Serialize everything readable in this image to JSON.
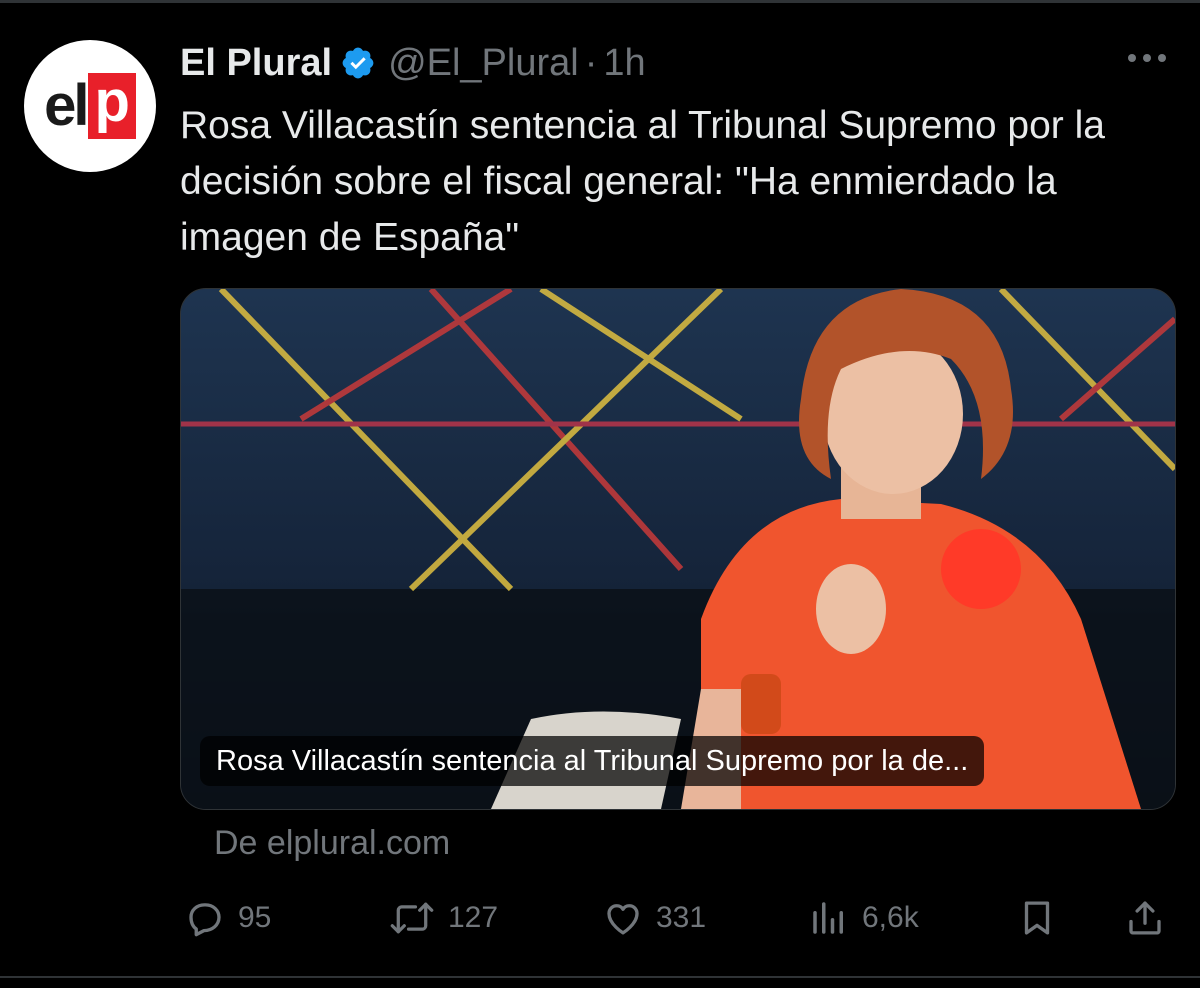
{
  "account": {
    "name": "El Plural",
    "handle": "@El_Plural",
    "separator": "·",
    "time": "1h",
    "logo_text_dark": "el",
    "logo_text_light": "p",
    "brand_red": "#e8202a",
    "verified_color": "#1d9bf0"
  },
  "tweet": {
    "text": "Rosa Villacastín sentencia al Tribunal Supremo por la decisión sobre el fiscal general: \"Ha enmierdado la imagen de España\""
  },
  "link_card": {
    "caption": "Rosa Villacastín sentencia al Tribunal Supremo por la de...",
    "source": "De elplural.com"
  },
  "actions": {
    "replies": "95",
    "reposts": "127",
    "likes": "331",
    "views": "6,6k"
  },
  "icons": [
    "verified-badge-icon",
    "more-icon",
    "reply-icon",
    "repost-icon",
    "like-icon",
    "views-icon",
    "bookmark-icon",
    "share-icon"
  ]
}
